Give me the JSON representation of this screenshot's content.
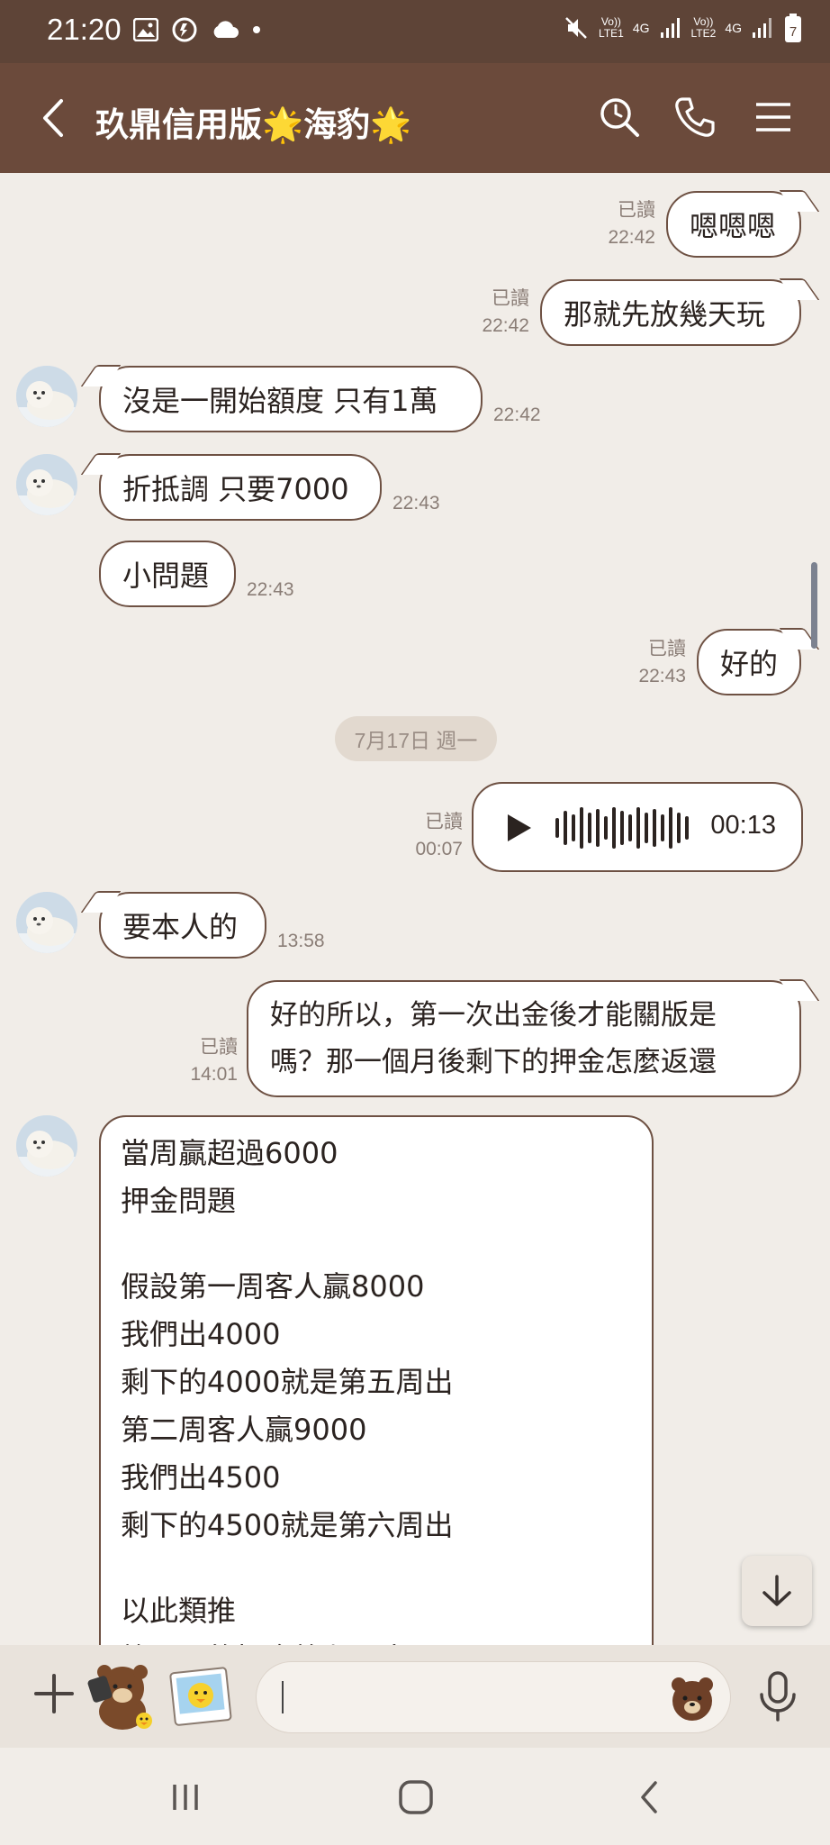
{
  "status_bar": {
    "time": "21:20",
    "sim1_label": "Vo))\nLTE1",
    "sim1_top": "Vo))",
    "sim1_bottom": "LTE1",
    "sim2_top": "Vo))",
    "sim2_bottom": "LTE2",
    "net1": "4G",
    "net2": "4G",
    "battery_level": "7"
  },
  "header": {
    "title": "玖鼎信用版🌟海豹🌟",
    "icons": [
      "back-icon",
      "search-icon",
      "phone-icon",
      "menu-icon"
    ]
  },
  "messages": [
    {
      "side": "right",
      "text": "嗯嗯嗯",
      "read": "已讀",
      "time": "22:42"
    },
    {
      "side": "right",
      "text": "那就先放幾天玩",
      "read": "已讀",
      "time": "22:42"
    },
    {
      "side": "left",
      "text": "沒是一開始額度 只有1萬",
      "time": "22:42"
    },
    {
      "side": "left",
      "text": "折抵調 只要7000",
      "time": "22:43"
    },
    {
      "side": "left",
      "text": "小問題",
      "time": "22:43"
    },
    {
      "side": "right",
      "text": "好的",
      "read": "已讀",
      "time": "22:43"
    },
    {
      "date_separator": "7月17日 週一"
    },
    {
      "side": "right",
      "type": "voice",
      "duration": "00:13",
      "read": "已讀",
      "time": "00:07"
    },
    {
      "side": "left",
      "text": "要本人的",
      "time": "13:58"
    },
    {
      "side": "right",
      "lines": [
        "好的所以，第一次出金後才能關版是",
        "嗎？那一個月後剩下的押金怎麼返還"
      ],
      "read": "已讀",
      "time": "14:01"
    },
    {
      "side": "left",
      "lines": [
        "當周贏超過6000",
        "押金問題",
        "",
        "假設第一周客人贏8000",
        "我們出4000",
        "剩下的4000就是第五周出",
        "第二周客人贏9000",
        "我們出4500",
        "剩下的4500就是第六周出",
        "",
        "以此類推",
        "第三周的押金第七周出"
      ]
    }
  ],
  "input_bar": {
    "placeholder": "",
    "icons": [
      "plus-icon",
      "sticker-bear-icon",
      "sticker-photo-icon",
      "emoji-bear-icon",
      "mic-icon"
    ]
  },
  "colors": {
    "header_bg": "#6b4a3b",
    "status_bg": "#5e4437",
    "chat_bg": "#f1ede8",
    "bubble_border": "#6e5143"
  }
}
